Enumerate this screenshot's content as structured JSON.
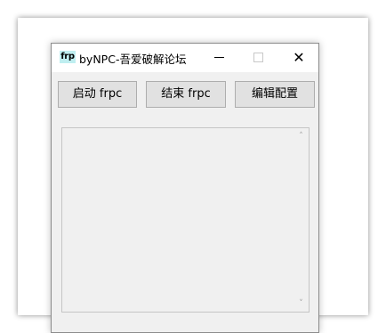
{
  "window": {
    "icon_text": "frp",
    "title": "byNPC-吾爱破解论坛",
    "close_glyph": "✕"
  },
  "toolbar": {
    "start_label": "启动 frpc",
    "stop_label": "结束 frpc",
    "edit_label": "编辑配置"
  },
  "log": {
    "content": "",
    "scroll_up_glyph": "˄",
    "scroll_down_glyph": "˅"
  },
  "colors": {
    "icon_bg": "#bfeef0",
    "window_bg": "#f0f0f0",
    "button_bg": "#e1e1e1"
  }
}
